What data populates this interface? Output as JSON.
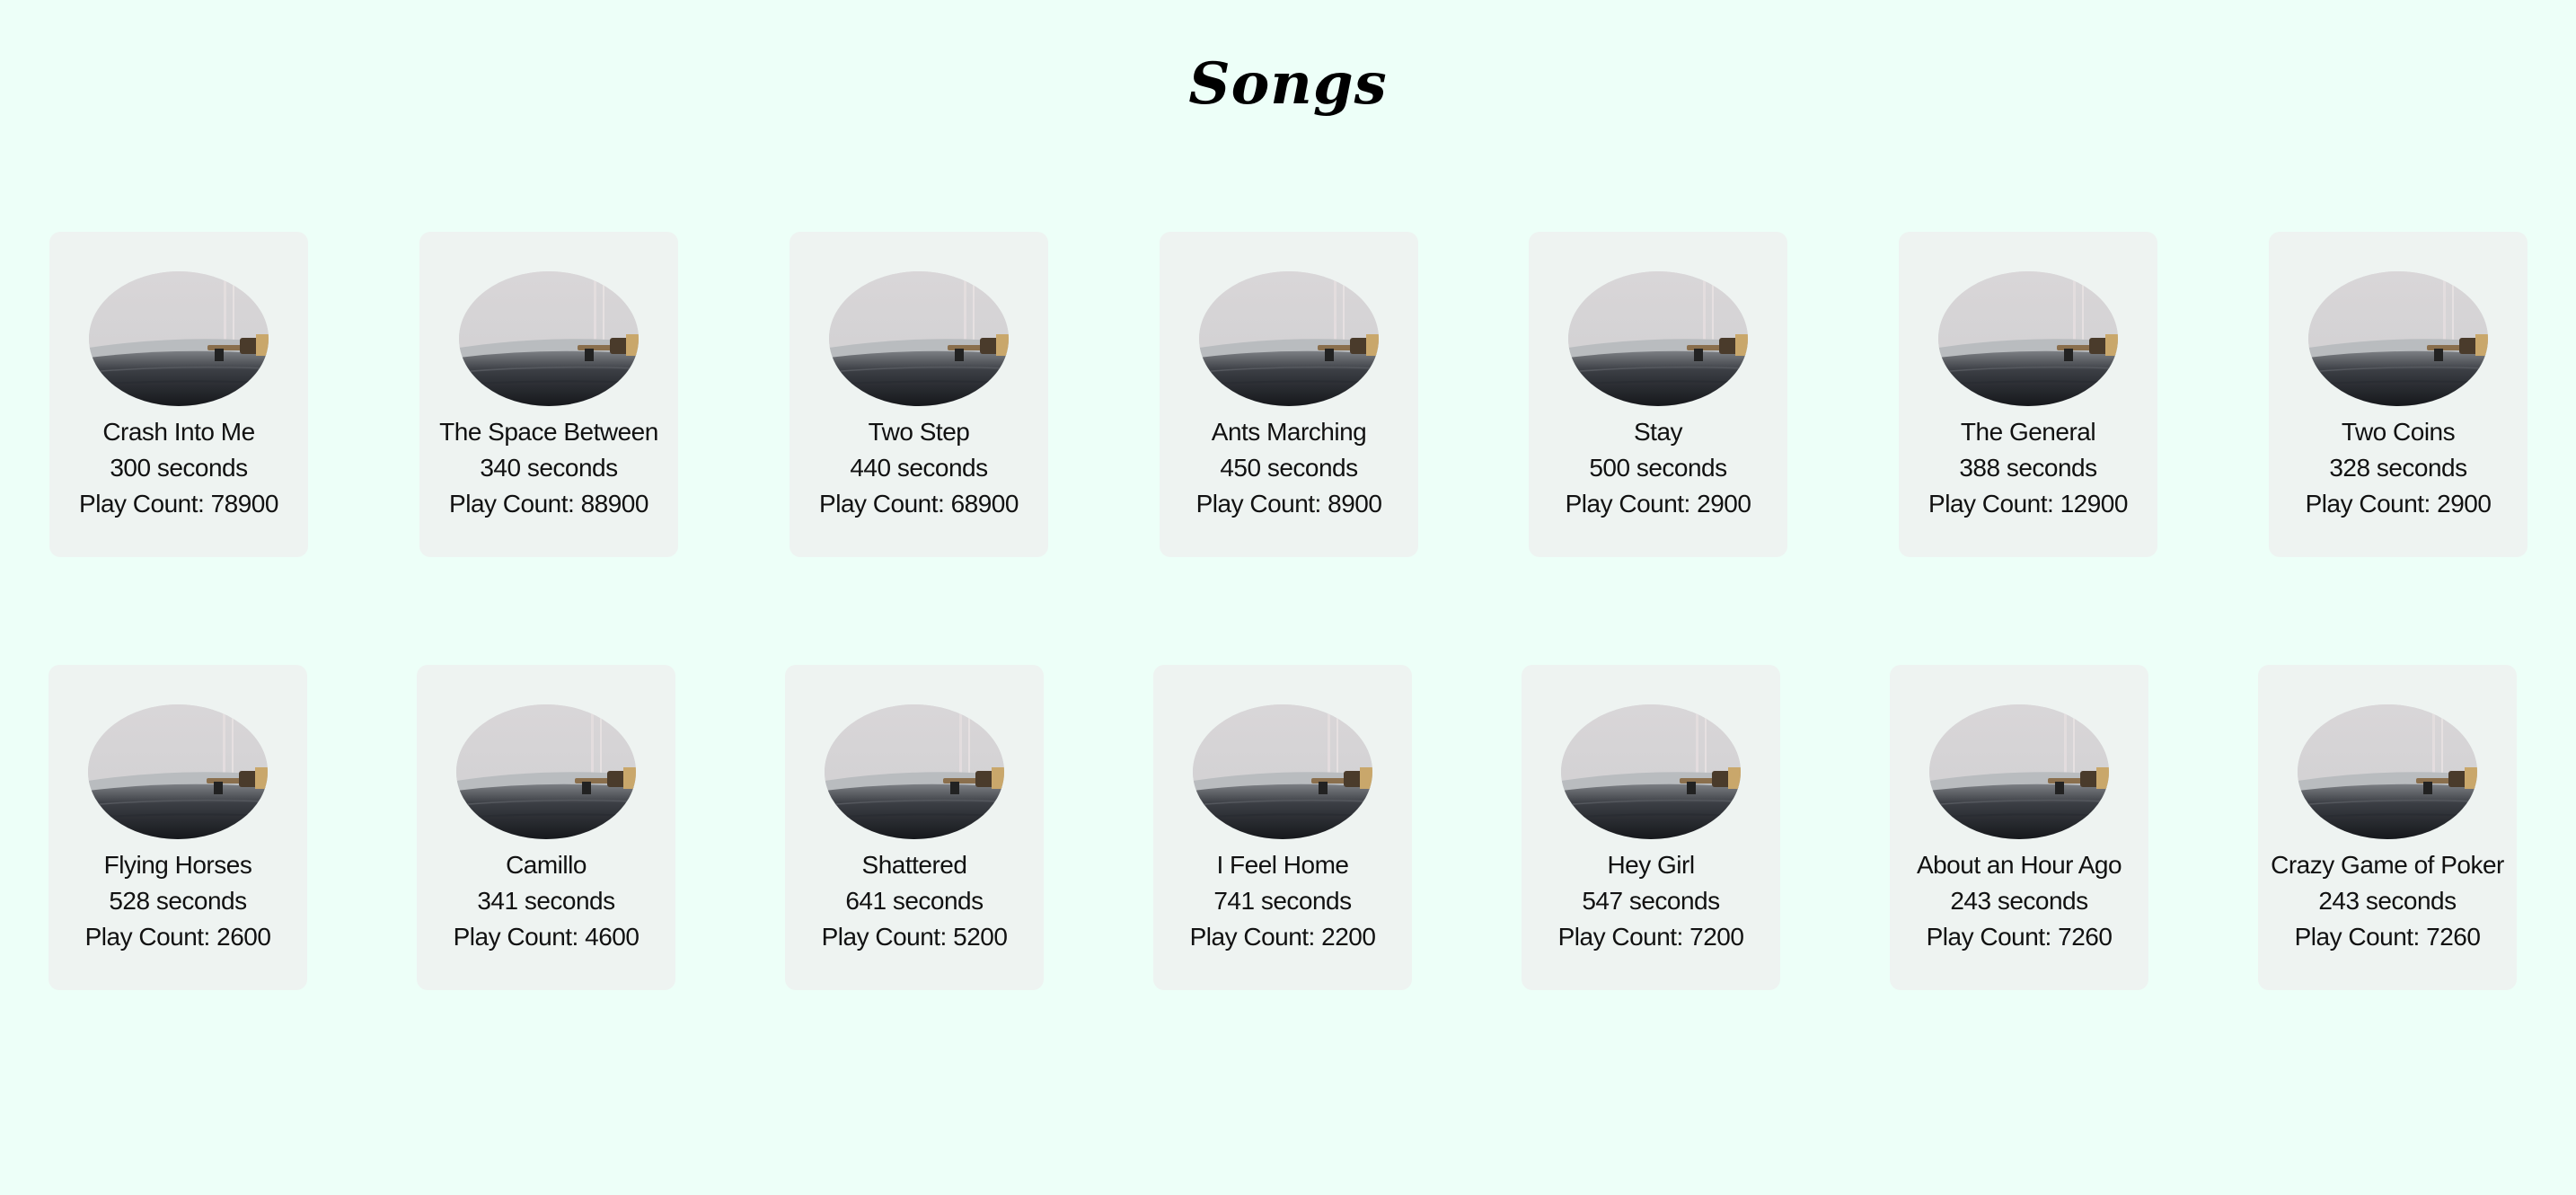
{
  "page": {
    "title": "Songs",
    "background": "#edfff8",
    "card_background": "#eef3f1"
  },
  "duration_suffix": "seconds",
  "play_count_label": "Play Count:",
  "thumbnail_icon": "vinyl-turntable-icon",
  "songs": [
    {
      "title": "Crash Into Me",
      "duration": "300 seconds",
      "play_count": "Play Count: 78900"
    },
    {
      "title": "The Space Between",
      "duration": "340 seconds",
      "play_count": "Play Count: 88900"
    },
    {
      "title": "Two Step",
      "duration": "440 seconds",
      "play_count": "Play Count: 68900"
    },
    {
      "title": "Ants Marching",
      "duration": "450 seconds",
      "play_count": "Play Count: 8900"
    },
    {
      "title": "Stay",
      "duration": "500 seconds",
      "play_count": "Play Count: 2900"
    },
    {
      "title": "The General",
      "duration": "388 seconds",
      "play_count": "Play Count: 12900"
    },
    {
      "title": "Two Coins",
      "duration": "328 seconds",
      "play_count": "Play Count: 2900"
    },
    {
      "title": "Flying Horses",
      "duration": "528 seconds",
      "play_count": "Play Count: 2600"
    },
    {
      "title": "Camillo",
      "duration": "341 seconds",
      "play_count": "Play Count: 4600"
    },
    {
      "title": "Shattered",
      "duration": "641 seconds",
      "play_count": "Play Count: 5200"
    },
    {
      "title": "I Feel Home",
      "duration": "741 seconds",
      "play_count": "Play Count: 2200"
    },
    {
      "title": "Hey Girl",
      "duration": "547 seconds",
      "play_count": "Play Count: 7200"
    },
    {
      "title": "About an Hour Ago",
      "duration": "243 seconds",
      "play_count": "Play Count: 7260"
    },
    {
      "title": "Crazy Game of Poker",
      "duration": "243 seconds",
      "play_count": "Play Count: 7260"
    }
  ]
}
